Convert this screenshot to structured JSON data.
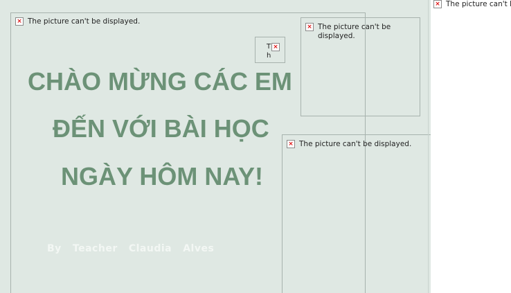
{
  "placeholders": {
    "top_left": "The picture can't be displayed.",
    "top_right_line1": "The picture can't be",
    "top_right_line2": "displayed.",
    "middle_right": "The picture can't be displayed.",
    "outside": "The picture can't be",
    "tiny_t": "T",
    "tiny_h": "h"
  },
  "title": {
    "line1": "CHÀO MỪNG CÁC EM",
    "line2": "ĐẾN VỚI BÀI HỌC",
    "line3": "NGÀY HÔM NAY!"
  },
  "byline": "By   Teacher   Claudia   Alves",
  "colors": {
    "slide_background": "#dfe8e3",
    "title_text": "#6c9277",
    "byline_text": "#f3f7f4"
  }
}
